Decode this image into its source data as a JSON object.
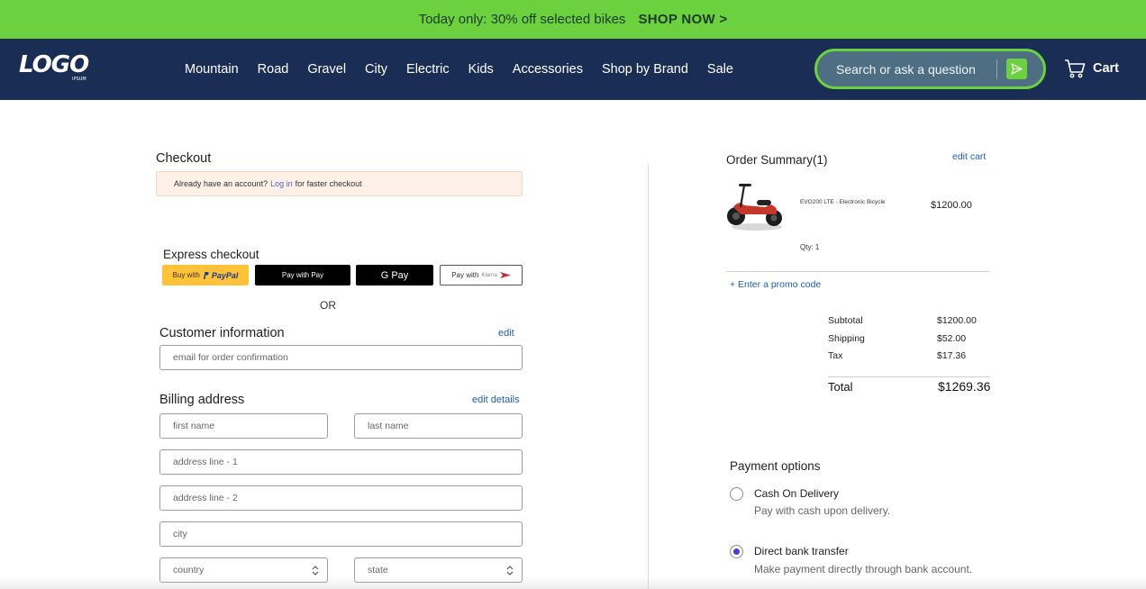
{
  "promo_bar": {
    "text": "Today only:  30% off selected bikes",
    "cta": "SHOP NOW >"
  },
  "brand": {
    "accent": "#6cd13f",
    "nav_bg": "#1a2d54"
  },
  "nav": {
    "logo_text": "LOGO",
    "logo_sub": "IPSUM",
    "items": [
      "Mountain",
      "Road",
      "Gravel",
      "City",
      "Electric",
      "Kids",
      "Accessories",
      "Shop by Brand",
      "Sale"
    ],
    "search_placeholder": "Search or ask a question",
    "cart_label": "Cart"
  },
  "checkout": {
    "title": "Checkout",
    "notice_prefix": "Already have an account?",
    "notice_link": "Log in",
    "notice_suffix": "for faster checkout",
    "express_title": "Express checkout",
    "express": {
      "paypal_prefix": "Buy with",
      "paypal_brand": "PayPal",
      "applepay": "Pay with  Pay",
      "gpay": "G Pay",
      "klarna_prefix": "Pay with",
      "klarna_brand": "Klarna"
    },
    "or": "OR",
    "customer_title": "Customer information",
    "customer_edit": "edit",
    "email_placeholder": "email for order confirmation",
    "billing_title": "Billing address",
    "billing_edit": "edit details",
    "first_name_placeholder": "first name",
    "last_name_placeholder": "last name",
    "address1_placeholder": "address line - 1",
    "address2_placeholder": "address line - 2",
    "city_placeholder": "city",
    "country_label": "country",
    "state_label": "state"
  },
  "summary": {
    "title": "Order Summary(1)",
    "edit_cart": "edit cart",
    "product_name": "EVO200 LTE - Electronic Bicycle",
    "product_price": "$1200.00",
    "qty": "Qty: 1",
    "promo_code": "+ Enter a promo code",
    "rows": [
      {
        "label": "Subtotal",
        "value": "$1200.00"
      },
      {
        "label": "Shipping",
        "value": "$52.00"
      },
      {
        "label": "Tax",
        "value": "$17.36"
      }
    ],
    "total_label": "Total",
    "total_value": "$1269.36"
  },
  "payment": {
    "title": "Payment options",
    "options": [
      {
        "title": "Cash On Delivery",
        "desc": "Pay with cash upon delivery.",
        "selected": false
      },
      {
        "title": "Direct bank transfer",
        "desc": "Make payment directly through bank account.",
        "selected": true
      }
    ]
  }
}
